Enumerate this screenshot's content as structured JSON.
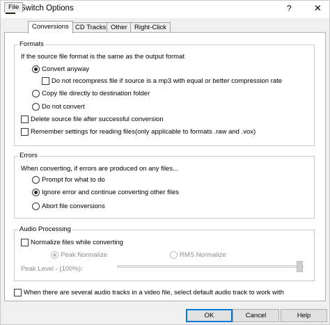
{
  "window": {
    "title": "Switch Options",
    "help_glyph": "?",
    "close_glyph": "✕"
  },
  "tabs": [
    {
      "label": "File",
      "active": false
    },
    {
      "label": "Conversions",
      "active": true
    },
    {
      "label": "CD Tracks",
      "active": false
    },
    {
      "label": "Other",
      "active": false
    },
    {
      "label": "Right-Click",
      "active": false
    }
  ],
  "formats": {
    "legend": "Formats",
    "intro": "If the source file format is the same as the output format",
    "convert_anyway": "Convert anyway",
    "do_not_recompress": "Do not recompress file if source is a mp3 with equal or better compression rate",
    "copy_directly": "Copy file directly to destination folder",
    "do_not_convert": "Do not convert",
    "delete_source": "Delete source file after successful conversion",
    "remember_settings": "Remember settings for reading files(only applicable to formats .raw and .vox)"
  },
  "errors": {
    "legend": "Errors",
    "intro": "When converting, if errors are produced on any files...",
    "prompt": "Prompt for what to do",
    "ignore": "Ignore error and continue converting other files",
    "abort": "Abort file conversions"
  },
  "audio": {
    "legend": "Audio Processing",
    "normalize": "Normalize files while converting",
    "peak_normalize": "Peak Normalize",
    "rms_normalize": "RMS Normalize",
    "peak_level": "Peak Level - (100%):",
    "peak_level_value": 100
  },
  "audio_tracks_option": "When there are several audio tracks in a video file, select default audio track to work with",
  "buttons": {
    "ok": "OK",
    "cancel": "Cancel",
    "help": "Help"
  },
  "colors": {
    "default_button_border": "#0078d7",
    "disabled_text": "#8c8c8c"
  }
}
